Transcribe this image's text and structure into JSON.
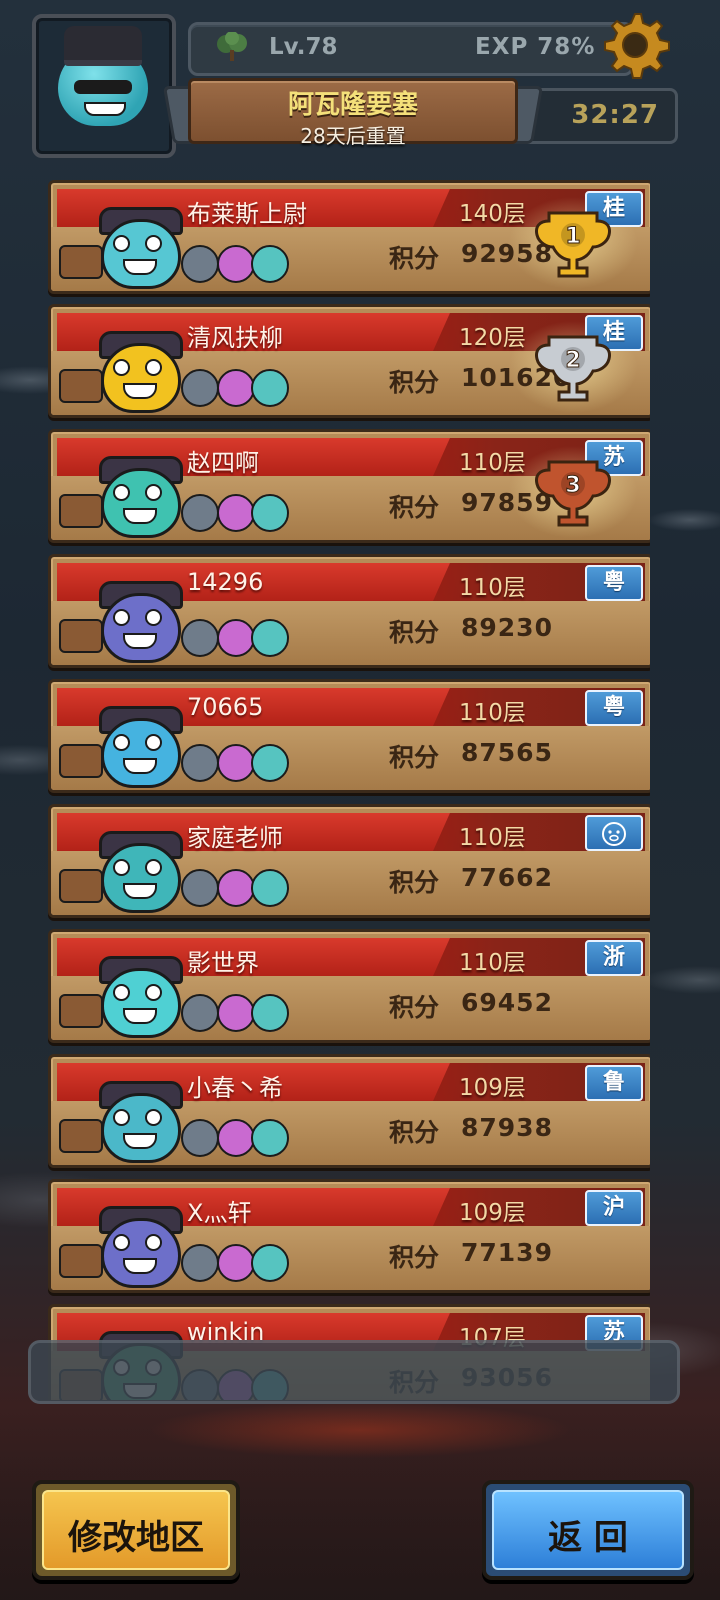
{
  "header": {
    "level": "Lv.78",
    "exp": "EXP 78%",
    "timer": "32:27",
    "dungeon_title": "阿瓦隆要塞",
    "reset_text": "28天后重置"
  },
  "score_label": "积分",
  "rankings": [
    {
      "name": "布莱斯上尉",
      "layer": "140层",
      "score": "92958",
      "region": "桂",
      "trophy": "gold",
      "trophy_label": "1",
      "color": "#56c7d3"
    },
    {
      "name": "清风扶柳",
      "layer": "120层",
      "score": "101620",
      "region": "桂",
      "trophy": "silver",
      "trophy_label": "2",
      "color": "#f2c21f"
    },
    {
      "name": "赵四啊",
      "layer": "110层",
      "score": "97859",
      "region": "苏",
      "trophy": "bronze",
      "trophy_label": "3",
      "color": "#3fc2b0"
    },
    {
      "name": "14296",
      "layer": "110层",
      "score": "89230",
      "region": "粤",
      "trophy": "",
      "trophy_label": "",
      "color": "#6d6fc9"
    },
    {
      "name": "70665",
      "layer": "110层",
      "score": "87565",
      "region": "粤",
      "trophy": "",
      "trophy_label": "",
      "color": "#45b3e0"
    },
    {
      "name": "家庭老师",
      "layer": "110层",
      "score": "77662",
      "region": "pig-icon",
      "trophy": "",
      "trophy_label": "",
      "color": "#3fb6b9"
    },
    {
      "name": "影世界",
      "layer": "110层",
      "score": "69452",
      "region": "浙",
      "trophy": "",
      "trophy_label": "",
      "color": "#4fd0d3"
    },
    {
      "name": "小春丶希",
      "layer": "109层",
      "score": "87938",
      "region": "鲁",
      "trophy": "",
      "trophy_label": "",
      "color": "#4bb8c9"
    },
    {
      "name": "X灬轩",
      "layer": "109层",
      "score": "77139",
      "region": "沪",
      "trophy": "",
      "trophy_label": "",
      "color": "#6d6fc9"
    },
    {
      "name": "winkin",
      "layer": "107层",
      "score": "93056",
      "region": "苏",
      "trophy": "",
      "trophy_label": "",
      "color": "#49b07a"
    }
  ],
  "buttons": {
    "change_region": "修改地区",
    "back": "返 回"
  },
  "colors": {
    "gold": "#f0b726",
    "silver": "#c7ccd2",
    "bronze": "#c0542e",
    "name_strip": "#c92b1f",
    "region_badge": "#2c6fb3"
  }
}
